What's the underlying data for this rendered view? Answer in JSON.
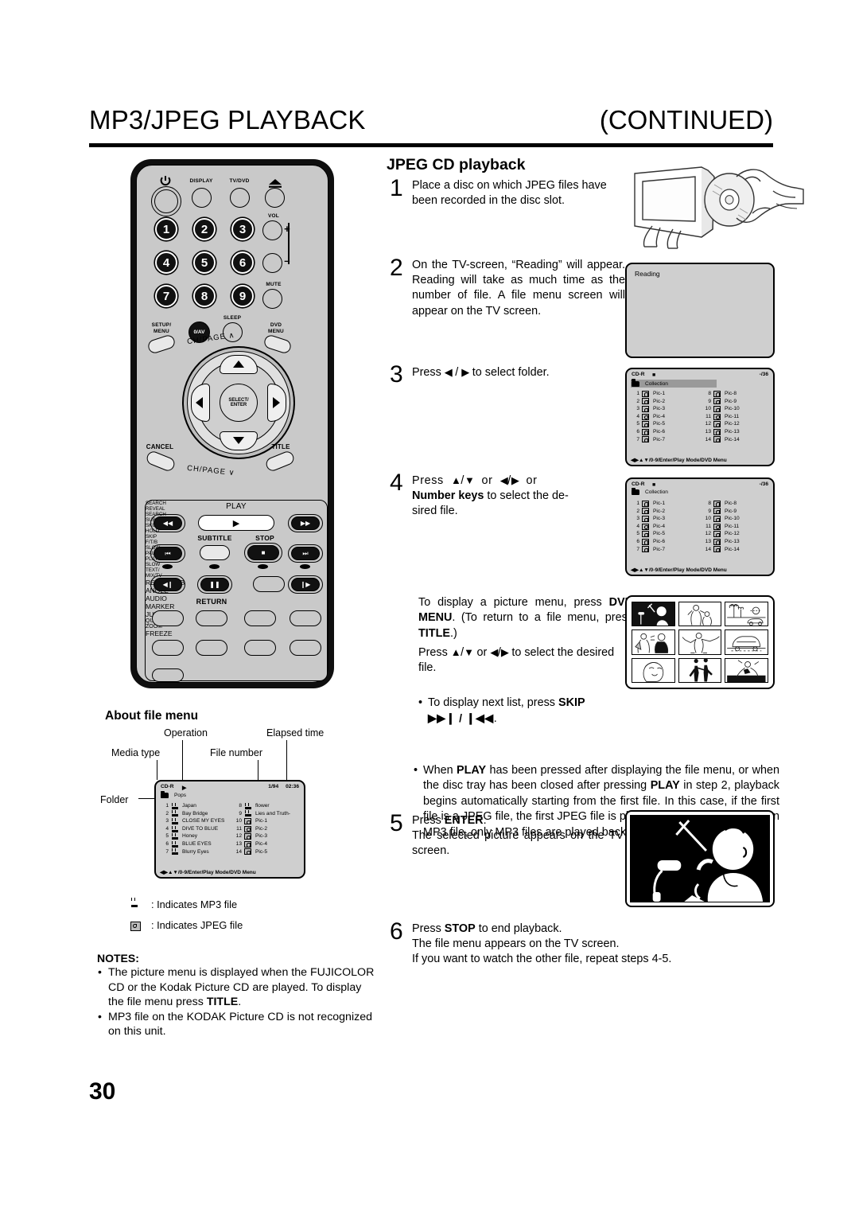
{
  "header": {
    "title": "MP3/JPEG PLAYBACK",
    "continued": "(CONTINUED)",
    "page_number": "30"
  },
  "section": {
    "heading": "JPEG CD playback"
  },
  "steps": [
    {
      "number": "1",
      "text": "Place a disc on which JPEG files have been recorded in the disc slot."
    },
    {
      "number": "2",
      "text": "On the TV-screen, “Reading” will appear. Reading will take as much time as the number of file. A file menu screen will appear on the TV screen."
    },
    {
      "number": "3",
      "text": "Press ◀ / ▶ to select folder."
    },
    {
      "number": "4",
      "text": "Press ▲/▼ or ◀/▶ or Number keys to select the desired file."
    },
    {
      "number": "5",
      "text": "Press ENTER. The selected picture appears on the TV screen."
    },
    {
      "number": "6",
      "text": "Press STOP to end playback. The file menu appears on the TV screen. If you want to watch the other file, repeat steps 4-5."
    }
  ],
  "step4": {
    "line1_a": "Press ",
    "line1_b": " or ",
    "line1_c": " or",
    "line2_bold": "Number keys",
    "line2_rest": " to select the de-",
    "line3": "sired file."
  },
  "step5": {
    "press": "Press ",
    "enter": "ENTER",
    "period": ".",
    "rest": "The selected picture appears on the TV screen."
  },
  "step6": {
    "press": "Press ",
    "stop": "STOP",
    "rest1": " to end playback.",
    "rest2": "The file menu appears on the TV screen.",
    "rest3": "If you want to watch the other file, repeat steps 4-5."
  },
  "notes_right": {
    "p1_a": "To display a picture menu, press ",
    "p1_b": "DVD MENU",
    "p1_c": ". (To return to a file menu, press ",
    "p1_d": "TITLE",
    "p1_e": ".)",
    "p2_a": "Press ",
    "p2_b": " or ",
    "p2_c": " to select the desired file.",
    "b1_a": "To display next list, press ",
    "b1_b": "SKIP",
    "b1_c": " ▶▶❘ / ❘◀◀ .",
    "b2": "When PLAY has been pressed after displaying the file menu, or when the disc tray has been closed after pressing PLAY in step 2, playback begins automatically starting from the first file. In this case, if the first file is a JPEG file, the first JPEG file is played back. If the first file is an MP3 file, only MP3 files are played back in order."
  },
  "about_file_menu": {
    "title": "About file menu",
    "callouts": {
      "operation": "Operation",
      "elapsed_time": "Elapsed time",
      "media_type": "Media type",
      "file_number": "File number",
      "folder": "Folder"
    },
    "screen": {
      "media": "CD-R",
      "op_icon": "play-icon",
      "file_number": "1/94",
      "elapsed": "02:36",
      "folder_name": "Pops",
      "footer": "◀▶▲▼/0-9/Enter/Play Mode/DVD Menu",
      "left_items": [
        {
          "n": "1",
          "type": "mp3",
          "name": "Japan",
          "selected": true
        },
        {
          "n": "2",
          "type": "mp3",
          "name": "Bay Bridge",
          "selected": false
        },
        {
          "n": "3",
          "type": "mp3",
          "name": "CLOSE MY EYES",
          "selected": false
        },
        {
          "n": "4",
          "type": "mp3",
          "name": "DIVE TO BLUE",
          "selected": false
        },
        {
          "n": "5",
          "type": "mp3",
          "name": "Honey",
          "selected": false
        },
        {
          "n": "6",
          "type": "mp3",
          "name": "BLUE EYES",
          "selected": false
        },
        {
          "n": "7",
          "type": "mp3",
          "name": "Blurry Eyes",
          "selected": false
        }
      ],
      "right_items": [
        {
          "n": "8",
          "type": "mp3",
          "name": "flower",
          "selected": false
        },
        {
          "n": "9",
          "type": "mp3",
          "name": "Lies and Truth-",
          "selected": false
        },
        {
          "n": "10",
          "type": "jpeg",
          "name": "Pic-1",
          "selected": false
        },
        {
          "n": "11",
          "type": "jpeg",
          "name": "Pic-2",
          "selected": false
        },
        {
          "n": "12",
          "type": "jpeg",
          "name": "Pic-3",
          "selected": false
        },
        {
          "n": "13",
          "type": "jpeg",
          "name": "Pic-4",
          "selected": false
        },
        {
          "n": "14",
          "type": "jpeg",
          "name": "Pic-5",
          "selected": false
        }
      ]
    }
  },
  "legend": [
    {
      "icon": "mp3-icon",
      "text": ": Indicates MP3 file"
    },
    {
      "icon": "jpeg-icon",
      "text": ": Indicates JPEG file"
    }
  ],
  "notes_left": {
    "title": "NOTES:",
    "items": [
      "The picture menu is displayed when the FUJICOLOR CD or the Kodak Picture CD are played. To display the file menu press TITLE.",
      "MP3 file on the KODAK Picture CD is not recognized on this unit."
    ]
  },
  "osd_reading": {
    "text": "Reading"
  },
  "osd_folder": {
    "media": "CD-R",
    "op_icon": "stop-icon",
    "counter": "-/36",
    "folder_name": "Collection",
    "folder_selected": true,
    "footer": "◀▶▲▼/0-9/Enter/Play Mode/DVD Menu",
    "left_items": [
      {
        "n": "1",
        "name": "Pic-1"
      },
      {
        "n": "2",
        "name": "Pic-2"
      },
      {
        "n": "3",
        "name": "Pic-3"
      },
      {
        "n": "4",
        "name": "Pic-4"
      },
      {
        "n": "5",
        "name": "Pic-5"
      },
      {
        "n": "6",
        "name": "Pic-6"
      },
      {
        "n": "7",
        "name": "Pic-7"
      }
    ],
    "right_items": [
      {
        "n": "8",
        "name": "Pic-8"
      },
      {
        "n": "9",
        "name": "Pic-9"
      },
      {
        "n": "10",
        "name": "Pic-10"
      },
      {
        "n": "11",
        "name": "Pic-11"
      },
      {
        "n": "12",
        "name": "Pic-12"
      },
      {
        "n": "13",
        "name": "Pic-13"
      },
      {
        "n": "14",
        "name": "Pic-14"
      }
    ]
  },
  "osd_file": {
    "media": "CD-R",
    "op_icon": "stop-icon",
    "counter": "-/36",
    "folder_name": "Collection",
    "folder_selected": false,
    "selected_file": "Pic-1",
    "footer": "◀▶▲▼/0-9/Enter/Play Mode/DVD Menu",
    "left_items": [
      {
        "n": "1",
        "name": "Pic-1"
      },
      {
        "n": "2",
        "name": "Pic-2"
      },
      {
        "n": "3",
        "name": "Pic-3"
      },
      {
        "n": "4",
        "name": "Pic-4"
      },
      {
        "n": "5",
        "name": "Pic-5"
      },
      {
        "n": "6",
        "name": "Pic-6"
      },
      {
        "n": "7",
        "name": "Pic-7"
      }
    ],
    "right_items": [
      {
        "n": "8",
        "name": "Pic-8"
      },
      {
        "n": "9",
        "name": "Pic-9"
      },
      {
        "n": "10",
        "name": "Pic-10"
      },
      {
        "n": "11",
        "name": "Pic-11"
      },
      {
        "n": "12",
        "name": "Pic-12"
      },
      {
        "n": "13",
        "name": "Pic-13"
      },
      {
        "n": "14",
        "name": "Pic-14"
      }
    ]
  },
  "remote": {
    "labels": {
      "power": "power-icon",
      "display": "DISPLAY",
      "tv_dvd": "TV/DVD",
      "eject": "eject-icon",
      "vol": "VOL",
      "vol_plus": "+",
      "vol_minus": "–",
      "mute": "MUTE",
      "sleep": "SLEEP",
      "setup_menu_1": "SETUP/",
      "setup_menu_2": "MENU",
      "zero_av": "0/AV",
      "dvd_menu_1": "DVD",
      "dvd_menu_2": "MENU",
      "ch_page_up": "CH/PAGE ∧",
      "ch_page_down": "CH/PAGE ∨",
      "select_enter_1": "SELECT/",
      "select_enter_2": "ENTER",
      "cancel": "CANCEL",
      "title": "TITLE",
      "search_1": "SEARCH",
      "reveal": "REVEAL",
      "play": "PLAY",
      "search_2": "SEARCH",
      "sub_page": "SUB PAGE",
      "skip_1": "SKIP",
      "hold": "HOLD",
      "subtitle": "SUBTITLE",
      "stop": "STOP",
      "skip_2": "SKIP",
      "ftb": "F/T/B",
      "slow_l": "SLOW",
      "pause_still": "PAUSE/STILL",
      "play_mode": "PLAY MODE",
      "slow_r": "SLOW",
      "text_1": "TEXT/",
      "mix_tv": "MIX/TV",
      "return": "RETURN",
      "repeat_ab": "REPEAT A-B",
      "angle": "ANGLE",
      "audio": "AUDIO",
      "marker": "MARKER",
      "jump": "JUMP",
      "quick_view_1": "QUICK VIEW/",
      "zoom": "ZOOM",
      "freeze": "FREEZE"
    },
    "numbers": [
      "1",
      "2",
      "3",
      "4",
      "5",
      "6",
      "7",
      "8",
      "9"
    ]
  },
  "colors": {
    "remote_body": "#c9c9c9",
    "remote_frame": "#0f0f0f",
    "osd_bg": "#cfcfcf",
    "highlight": "#9a9a9a",
    "text": "#000000"
  }
}
